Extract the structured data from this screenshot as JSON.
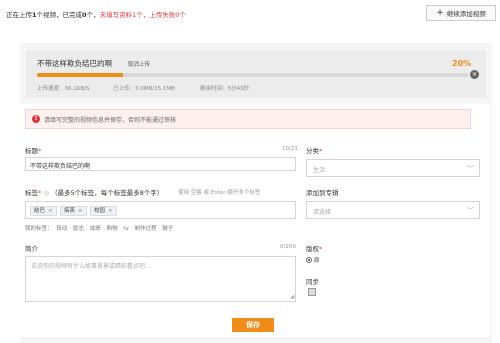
{
  "top": {
    "status": {
      "p1": "正在上传",
      "count_total": "1",
      "p2": "个视频，已完成",
      "count_done": "0",
      "p3": "个，",
      "warn": "未填写资料1个，上传失败0个"
    },
    "add_more_label": "继续添加视频",
    "add_more_icon": "plus-icon"
  },
  "upload": {
    "video_title": "不带这样欺负结巴的啊",
    "cancel_label": "取消上传",
    "percent_label": "20%",
    "progress": 0.2,
    "speed_label": "上传速度：",
    "speed_value": "36.1KB/S",
    "uploaded_label": "已上传：",
    "uploaded_value": "3.0MB/15.1MB",
    "remaining_label": "剩余时间：",
    "remaining_value": "5分43秒",
    "close_icon": "close-icon"
  },
  "alert": {
    "icon": "exclamation-icon",
    "text": "请填写完整的视频信息并保存，否则不能通过审核"
  },
  "form": {
    "title": {
      "label": "标题",
      "required": "*",
      "counter": "10/21",
      "value": "不带这样欺负结巴的啊"
    },
    "category": {
      "label": "分类",
      "required": "*",
      "placeholder": "生活"
    },
    "tags": {
      "label": "标签",
      "required": "*",
      "hint": "（最多5个标签，每个标签最多8个字）",
      "sep_hint": "使用 空格 或 Enter 顺开多个标签",
      "items": [
        "结巴",
        "搞笑",
        "校园"
      ],
      "my_tags_label": "我的标签：",
      "my_tags": [
        "段动",
        "励志",
        "成绩",
        "购物",
        "tv",
        "制作过程",
        "鼓子"
      ]
    },
    "album": {
      "label": "添加到专辑",
      "placeholder": "请选择"
    },
    "description": {
      "label": "简介",
      "counter": "0/200",
      "placeholder": "说说你的视频有什么故事背景或精彩看点吧..."
    },
    "copyright": {
      "label": "版权",
      "required": "*",
      "option": "原"
    },
    "sync": {
      "label": "同步"
    },
    "save_label": "保存"
  },
  "colors": {
    "accent": "#f08c1a",
    "warn": "#e4393c"
  }
}
